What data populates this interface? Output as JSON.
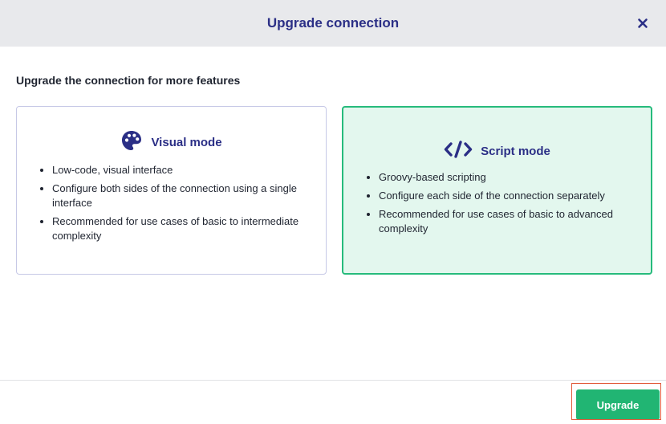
{
  "header": {
    "title": "Upgrade connection",
    "close_icon": "close-icon"
  },
  "subtitle": "Upgrade the connection for more features",
  "cards": [
    {
      "id": "visual",
      "icon": "palette-icon",
      "title": "Visual mode",
      "selected": false,
      "features": [
        "Low-code, visual interface",
        "Configure both sides of the connection using a single interface",
        "Recommended for use cases of basic to intermediate complexity"
      ]
    },
    {
      "id": "script",
      "icon": "code-icon",
      "title": "Script mode",
      "selected": true,
      "features": [
        "Groovy-based scripting",
        "Configure each side of the connection separately",
        "Recommended for use cases of basic to advanced complexity"
      ]
    }
  ],
  "footer": {
    "upgrade_label": "Upgrade"
  },
  "colors": {
    "header_bg": "#e8e9ec",
    "title": "#2b2f86",
    "accent_green": "#21b573",
    "selected_bg": "#e3f7ee",
    "highlight": "#e25b3c"
  }
}
